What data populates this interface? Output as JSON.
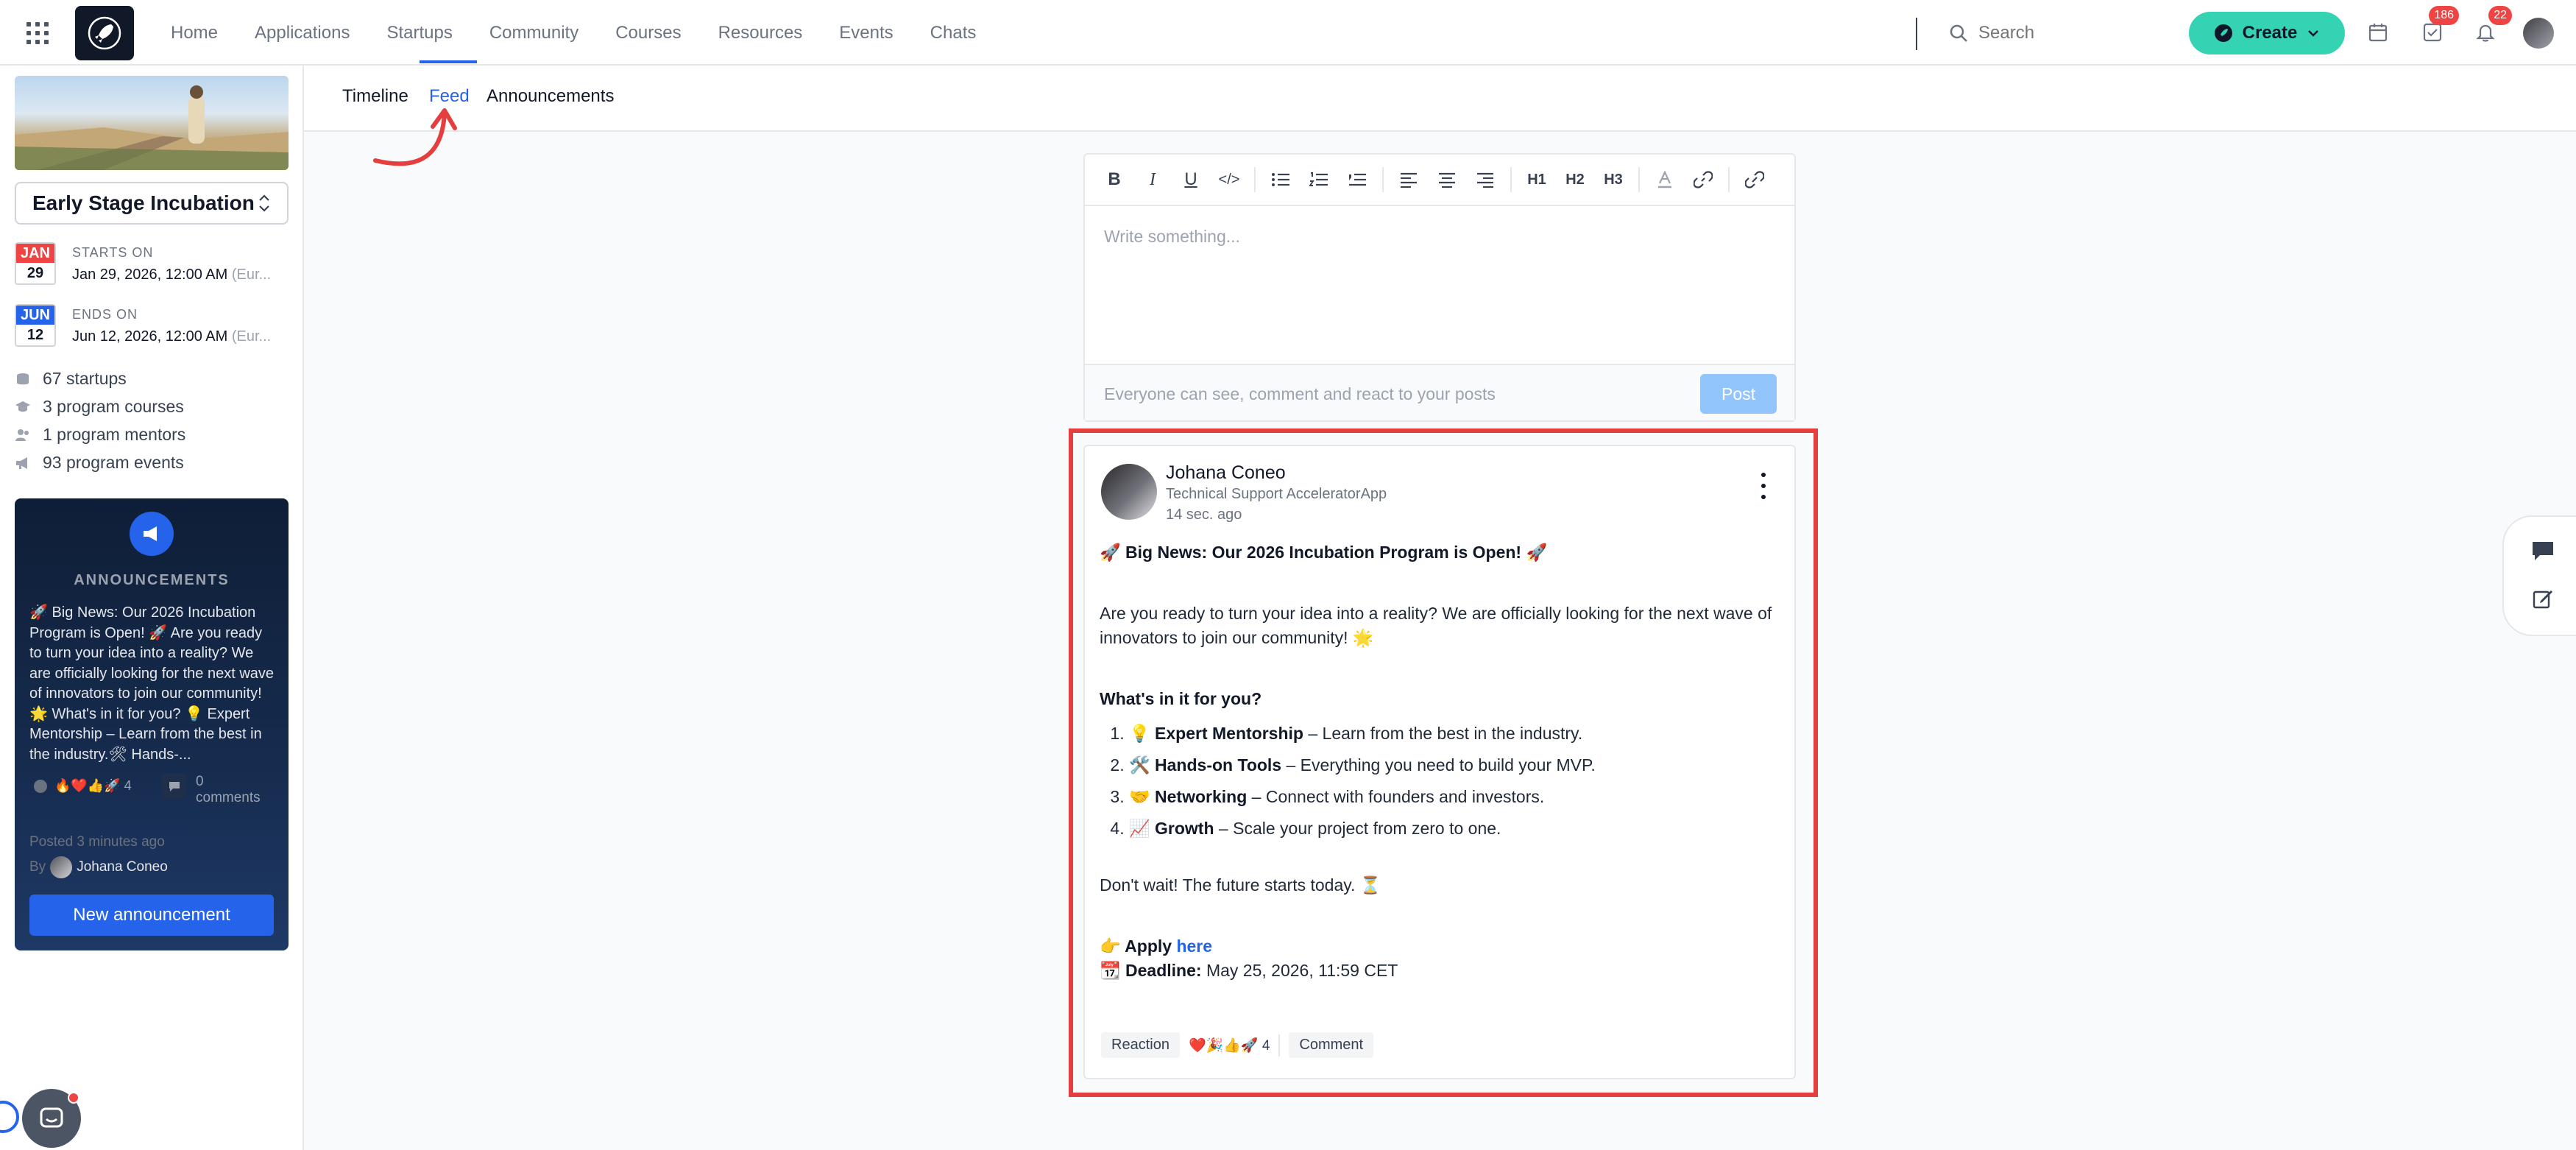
{
  "nav": {
    "items": [
      "Home",
      "Applications",
      "Startups",
      "Community",
      "Courses",
      "Resources",
      "Events",
      "Chats"
    ],
    "search_placeholder": "Search",
    "create_label": "Create",
    "tasks_badge": "186",
    "notifications_badge": "22"
  },
  "sidebar": {
    "program_name": "Early Stage Incubation",
    "start": {
      "month": "JAN",
      "day": "29",
      "label": "STARTS ON",
      "value": "Jan 29, 2026, 12:00 AM",
      "tz": "(Eur..."
    },
    "end": {
      "month": "JUN",
      "day": "12",
      "label": "ENDS ON",
      "value": "Jun 12, 2026, 12:00 AM",
      "tz": "(Eur..."
    },
    "stats": [
      "67 startups",
      "3 program courses",
      "1 program mentors",
      "93 program events"
    ],
    "announcement": {
      "title": "ANNOUNCEMENTS",
      "body": "🚀 Big News: Our 2026 Incubation Program is Open! 🚀 Are you ready to turn your idea into a reality? We are officially looking for the next wave of innovators to join our community! 🌟 What's in it for you? 💡 Expert Mentorship – Learn from the best in the industry.🛠 Hands-...",
      "reactions": "🔥❤️👍🚀 4",
      "comments": "0 comments",
      "posted": "Posted 3 minutes ago",
      "by_prefix": "By",
      "author": "Johana Coneo",
      "button": "New announcement"
    }
  },
  "tabs": [
    "Timeline",
    "Feed",
    "Announcements"
  ],
  "active_tab": "Feed",
  "editor": {
    "toolbar": [
      "B",
      "I",
      "U",
      "</>",
      "bullet-list",
      "numbered-list",
      "blockquote",
      "align-left",
      "align-center",
      "align-right",
      "H1",
      "H2",
      "H3",
      "text-color",
      "link",
      "unlink"
    ],
    "placeholder": "Write something...",
    "hint": "Everyone can see, comment and react to your posts",
    "post_label": "Post"
  },
  "post": {
    "author": "Johana Coneo",
    "role": "Technical Support AcceleratorApp",
    "time": "14 sec. ago",
    "headline": "🚀 Big News: Our 2026 Incubation Program is Open! 🚀",
    "intro": "Are you ready to turn your idea into a reality? We are officially looking for the next wave of innovators to join our community! 🌟",
    "subhead": "What's in it for you?",
    "list": [
      {
        "icon": "💡",
        "title": "Expert Mentorship",
        "text": " – Learn from the best in the industry."
      },
      {
        "icon": "🛠️",
        "title": "Hands-on Tools",
        "text": " – Everything you need to build your MVP."
      },
      {
        "icon": "🤝",
        "title": "Networking",
        "text": " – Connect with founders and investors."
      },
      {
        "icon": "📈",
        "title": "Growth",
        "text": " – Scale your project from zero to one."
      }
    ],
    "closing": "Don't wait! The future starts today. ⏳",
    "apply_prefix": "👉 Apply",
    "apply_link": "here",
    "deadline_label": "📆 Deadline:",
    "deadline_value": " May 25, 2026, 11:59 CET",
    "reaction_label": "Reaction",
    "reaction_summary": "❤️🎉👍🚀 4",
    "comment_label": "Comment"
  },
  "colors": {
    "accent": "#2563eb",
    "create": "#34d3b3",
    "highlight": "#e53e3e",
    "badge": "#ef4444"
  }
}
